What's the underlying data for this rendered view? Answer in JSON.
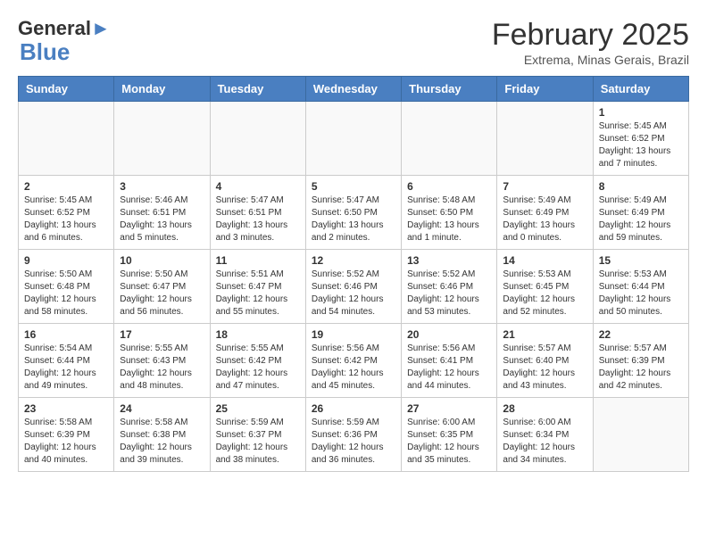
{
  "header": {
    "logo_line1": "General",
    "logo_line2": "Blue",
    "month_year": "February 2025",
    "location": "Extrema, Minas Gerais, Brazil"
  },
  "days_of_week": [
    "Sunday",
    "Monday",
    "Tuesday",
    "Wednesday",
    "Thursday",
    "Friday",
    "Saturday"
  ],
  "weeks": [
    [
      {
        "day": "",
        "info": ""
      },
      {
        "day": "",
        "info": ""
      },
      {
        "day": "",
        "info": ""
      },
      {
        "day": "",
        "info": ""
      },
      {
        "day": "",
        "info": ""
      },
      {
        "day": "",
        "info": ""
      },
      {
        "day": "1",
        "info": "Sunrise: 5:45 AM\nSunset: 6:52 PM\nDaylight: 13 hours\nand 7 minutes."
      }
    ],
    [
      {
        "day": "2",
        "info": "Sunrise: 5:45 AM\nSunset: 6:52 PM\nDaylight: 13 hours\nand 6 minutes."
      },
      {
        "day": "3",
        "info": "Sunrise: 5:46 AM\nSunset: 6:51 PM\nDaylight: 13 hours\nand 5 minutes."
      },
      {
        "day": "4",
        "info": "Sunrise: 5:47 AM\nSunset: 6:51 PM\nDaylight: 13 hours\nand 3 minutes."
      },
      {
        "day": "5",
        "info": "Sunrise: 5:47 AM\nSunset: 6:50 PM\nDaylight: 13 hours\nand 2 minutes."
      },
      {
        "day": "6",
        "info": "Sunrise: 5:48 AM\nSunset: 6:50 PM\nDaylight: 13 hours\nand 1 minute."
      },
      {
        "day": "7",
        "info": "Sunrise: 5:49 AM\nSunset: 6:49 PM\nDaylight: 13 hours\nand 0 minutes."
      },
      {
        "day": "8",
        "info": "Sunrise: 5:49 AM\nSunset: 6:49 PM\nDaylight: 12 hours\nand 59 minutes."
      }
    ],
    [
      {
        "day": "9",
        "info": "Sunrise: 5:50 AM\nSunset: 6:48 PM\nDaylight: 12 hours\nand 58 minutes."
      },
      {
        "day": "10",
        "info": "Sunrise: 5:50 AM\nSunset: 6:47 PM\nDaylight: 12 hours\nand 56 minutes."
      },
      {
        "day": "11",
        "info": "Sunrise: 5:51 AM\nSunset: 6:47 PM\nDaylight: 12 hours\nand 55 minutes."
      },
      {
        "day": "12",
        "info": "Sunrise: 5:52 AM\nSunset: 6:46 PM\nDaylight: 12 hours\nand 54 minutes."
      },
      {
        "day": "13",
        "info": "Sunrise: 5:52 AM\nSunset: 6:46 PM\nDaylight: 12 hours\nand 53 minutes."
      },
      {
        "day": "14",
        "info": "Sunrise: 5:53 AM\nSunset: 6:45 PM\nDaylight: 12 hours\nand 52 minutes."
      },
      {
        "day": "15",
        "info": "Sunrise: 5:53 AM\nSunset: 6:44 PM\nDaylight: 12 hours\nand 50 minutes."
      }
    ],
    [
      {
        "day": "16",
        "info": "Sunrise: 5:54 AM\nSunset: 6:44 PM\nDaylight: 12 hours\nand 49 minutes."
      },
      {
        "day": "17",
        "info": "Sunrise: 5:55 AM\nSunset: 6:43 PM\nDaylight: 12 hours\nand 48 minutes."
      },
      {
        "day": "18",
        "info": "Sunrise: 5:55 AM\nSunset: 6:42 PM\nDaylight: 12 hours\nand 47 minutes."
      },
      {
        "day": "19",
        "info": "Sunrise: 5:56 AM\nSunset: 6:42 PM\nDaylight: 12 hours\nand 45 minutes."
      },
      {
        "day": "20",
        "info": "Sunrise: 5:56 AM\nSunset: 6:41 PM\nDaylight: 12 hours\nand 44 minutes."
      },
      {
        "day": "21",
        "info": "Sunrise: 5:57 AM\nSunset: 6:40 PM\nDaylight: 12 hours\nand 43 minutes."
      },
      {
        "day": "22",
        "info": "Sunrise: 5:57 AM\nSunset: 6:39 PM\nDaylight: 12 hours\nand 42 minutes."
      }
    ],
    [
      {
        "day": "23",
        "info": "Sunrise: 5:58 AM\nSunset: 6:39 PM\nDaylight: 12 hours\nand 40 minutes."
      },
      {
        "day": "24",
        "info": "Sunrise: 5:58 AM\nSunset: 6:38 PM\nDaylight: 12 hours\nand 39 minutes."
      },
      {
        "day": "25",
        "info": "Sunrise: 5:59 AM\nSunset: 6:37 PM\nDaylight: 12 hours\nand 38 minutes."
      },
      {
        "day": "26",
        "info": "Sunrise: 5:59 AM\nSunset: 6:36 PM\nDaylight: 12 hours\nand 36 minutes."
      },
      {
        "day": "27",
        "info": "Sunrise: 6:00 AM\nSunset: 6:35 PM\nDaylight: 12 hours\nand 35 minutes."
      },
      {
        "day": "28",
        "info": "Sunrise: 6:00 AM\nSunset: 6:34 PM\nDaylight: 12 hours\nand 34 minutes."
      },
      {
        "day": "",
        "info": ""
      }
    ]
  ]
}
